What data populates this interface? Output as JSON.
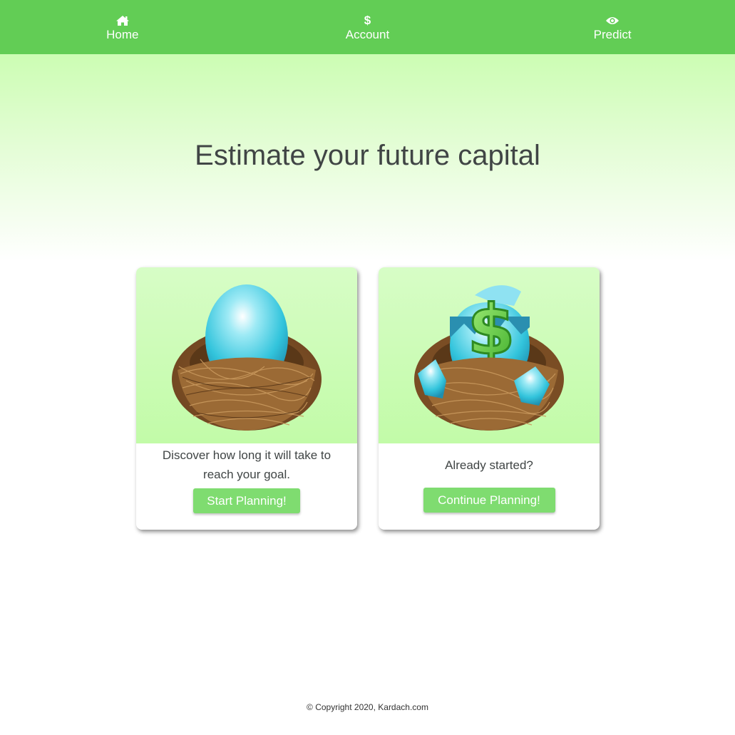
{
  "nav": {
    "items": [
      {
        "label": "Home",
        "icon": "home-icon"
      },
      {
        "label": "Account",
        "icon": "dollar-icon",
        "glyph": "$"
      },
      {
        "label": "Predict",
        "icon": "eye-icon"
      }
    ]
  },
  "hero": {
    "title": "Estimate your future capital"
  },
  "cards": [
    {
      "image": "nest-egg-image",
      "text": "Discover how long it will take to reach your goal.",
      "button_label": "Start Planning!"
    },
    {
      "image": "hatching-dollar-egg-image",
      "text": "Already started?",
      "button_label": "Continue Planning!"
    }
  ],
  "footer": {
    "copyright": "© Copyright 2020, Kardach.com"
  },
  "colors": {
    "navbar": "#62cd55",
    "button": "#7fdc70",
    "hero_top": "#ccfdb3",
    "text": "#404545"
  }
}
